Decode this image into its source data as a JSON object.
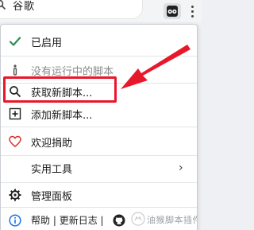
{
  "address_bar": {
    "text": "谷歌"
  },
  "menu": {
    "enabled_label": "已启用",
    "no_scripts_label": "没有运行中的脚本",
    "get_new_scripts_label": "获取新脚本...",
    "add_new_script_label": "添加新脚本...",
    "donate_label": "欢迎捐助",
    "utilities_label": "实用工具",
    "dashboard_label": "管理面板"
  },
  "footer": {
    "help_label": "帮助",
    "separator": " | ",
    "changelog_label": "更新日志",
    "separator2": " | ",
    "watermark": "油猴脚本插件"
  },
  "colors": {
    "accent_green": "#2e8b57",
    "highlight_red": "#e8182b",
    "heart_red": "#d9342b",
    "info_blue": "#1a73e8"
  }
}
